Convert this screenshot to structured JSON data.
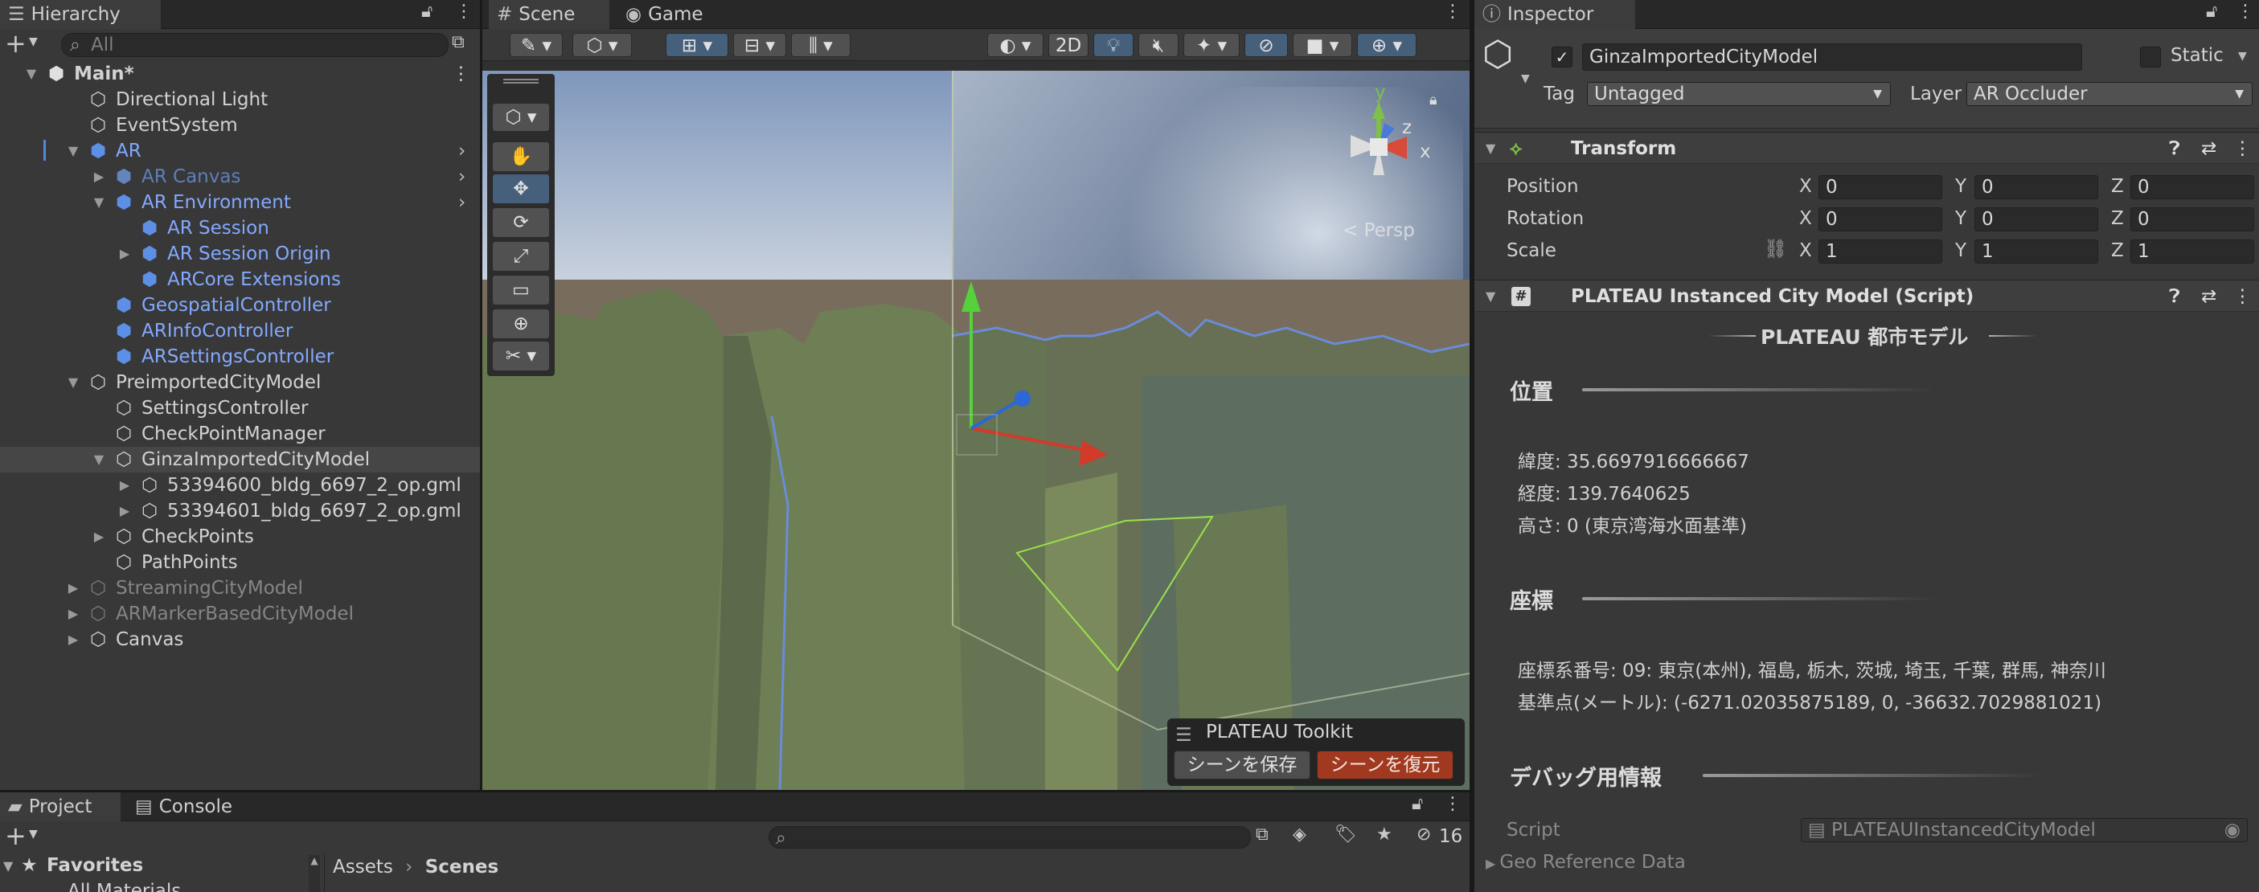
{
  "colors": {
    "selection": "#464646",
    "active_tool": "#46607c",
    "prefab_blue": "#83a9ff",
    "restore_button": "#a0391f"
  },
  "hierarchy": {
    "tab": "Hierarchy",
    "search_placeholder": "All",
    "items": [
      {
        "label": "Main*",
        "kind": "scene"
      },
      {
        "label": "Directional Light"
      },
      {
        "label": "EventSystem"
      },
      {
        "label": "AR",
        "style": "blue",
        "expand": "open"
      },
      {
        "label": "AR Canvas",
        "style": "blue-dim",
        "expand": "closed"
      },
      {
        "label": "AR Environment",
        "style": "blue",
        "expand": "open"
      },
      {
        "label": "AR Session",
        "style": "blue"
      },
      {
        "label": "AR Session Origin",
        "style": "blue",
        "expand": "closed"
      },
      {
        "label": "ARCore Extensions",
        "style": "blue"
      },
      {
        "label": "GeospatialController",
        "style": "blue"
      },
      {
        "label": "ARInfoController",
        "style": "blue"
      },
      {
        "label": "ARSettingsController",
        "style": "blue"
      },
      {
        "label": "PreimportedCityModel",
        "expand": "open"
      },
      {
        "label": "SettingsController"
      },
      {
        "label": "CheckPointManager"
      },
      {
        "label": "GinzaImportedCityModel",
        "expand": "open",
        "selected": true
      },
      {
        "label": "53394600_bldg_6697_2_op.gml",
        "expand": "closed"
      },
      {
        "label": "53394601_bldg_6697_2_op.gml",
        "expand": "closed"
      },
      {
        "label": "CheckPoints",
        "expand": "closed"
      },
      {
        "label": "PathPoints"
      },
      {
        "label": "StreamingCityModel",
        "style": "gray",
        "expand": "closed"
      },
      {
        "label": "ARMarkerBasedCityModel",
        "style": "gray",
        "expand": "closed"
      },
      {
        "label": "Canvas",
        "expand": "closed"
      }
    ]
  },
  "scene": {
    "tabs": [
      "Scene",
      "Game"
    ],
    "btn_2d": "2D",
    "persp_label": "< Persp",
    "gizmo": {
      "x": "x",
      "y": "y",
      "z": "z"
    },
    "toolkit": {
      "title": "PLATEAU Toolkit",
      "save": "シーンを保存",
      "restore": "シーンを復元"
    }
  },
  "inspector": {
    "tab": "Inspector",
    "object_name": "GinzaImportedCityModel",
    "static_label": "Static",
    "tag_label": "Tag",
    "tag_value": "Untagged",
    "layer_label": "Layer",
    "layer_value": "AR Occluder",
    "transform": {
      "title": "Transform",
      "rows": [
        {
          "label": "Position",
          "x": "0",
          "y": "0",
          "z": "0"
        },
        {
          "label": "Rotation",
          "x": "0",
          "y": "0",
          "z": "0"
        },
        {
          "label": "Scale",
          "x": "1",
          "y": "1",
          "z": "1"
        }
      ],
      "axis": {
        "x": "X",
        "y": "Y",
        "z": "Z"
      }
    },
    "script_component": {
      "title": "PLATEAU Instanced City Model (Script)",
      "banner": "PLATEAU 都市モデル",
      "sec_position": "位置",
      "latitude": "緯度: 35.6697916666667",
      "longitude": "経度: 139.7640625",
      "height": "高さ: 0 (東京湾海水面基準)",
      "sec_coords": "座標",
      "coord_system": "座標系番号: 09: 東京(本州), 福島, 栃木, 茨城, 埼玉, 千葉, 群馬, 神奈川",
      "ref_point": "基準点(メートル): (-6271.02035875189, 0, -36632.7029881021)",
      "sec_debug": "デバッグ用情報",
      "script_label": "Script",
      "script_value": "PLATEAUInstancedCityModel",
      "geo_ref": "Geo Reference Data"
    }
  },
  "project": {
    "tabs": [
      "Project",
      "Console"
    ],
    "favorites": "Favorites",
    "favorites_item": "All Materials",
    "breadcrumb": [
      "Assets",
      "Scenes"
    ],
    "hidden_count": "16"
  }
}
